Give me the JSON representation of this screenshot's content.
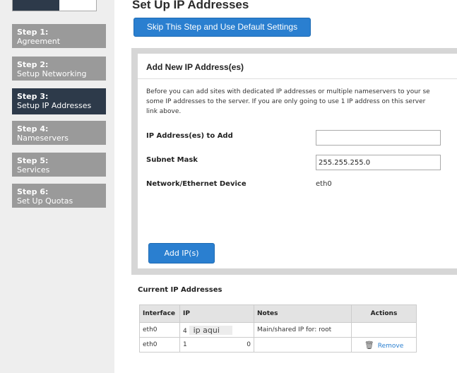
{
  "sidebar": {
    "steps": [
      {
        "title": "Step 1",
        "label": "Agreement"
      },
      {
        "title": "Step 2",
        "label": "Setup Networking"
      },
      {
        "title": "Step 3",
        "label": "Setup IP Addresses"
      },
      {
        "title": "Step 4",
        "label": "Nameservers"
      },
      {
        "title": "Step 5",
        "label": "Services"
      },
      {
        "title": "Step 6",
        "label": "Set Up Quotas"
      }
    ],
    "active_step": 3
  },
  "header": {
    "title": "Set Up IP Addresses",
    "skip_button": "Skip This Step and Use Default Settings"
  },
  "panel": {
    "title": "Add New IP Address(es)",
    "description_lines": [
      "Before you can add sites with dedicated IP addresses or multiple nameservers to your se",
      "some IP addresses to the server. If you are only going to use 1 IP address on this server",
      "link above."
    ],
    "ip_label": "IP Address(es) to Add",
    "ip_value": "",
    "subnet_label": "Subnet Mask",
    "subnet_value": "255.255.255.0",
    "device_label": "Network/Ethernet Device",
    "device_value": "eth0",
    "add_button": "Add IP(s)"
  },
  "current": {
    "title": "Current IP Addresses",
    "headers": [
      "Interface",
      "IP",
      "Notes",
      "Actions"
    ],
    "rows": [
      {
        "interface": "eth0",
        "ip_prefix": "4",
        "ip_rest": "ip aqui",
        "notes": "Main/shared IP for: root",
        "action": ""
      },
      {
        "interface": "eth0",
        "ip_prefix": "1",
        "ip_rest": "0",
        "notes": "",
        "action": "Remove"
      }
    ]
  },
  "colors": {
    "accent": "#2a7fd0",
    "sidebar_active": "#2d3a4a",
    "sidebar_step": "#9a9a9a"
  }
}
